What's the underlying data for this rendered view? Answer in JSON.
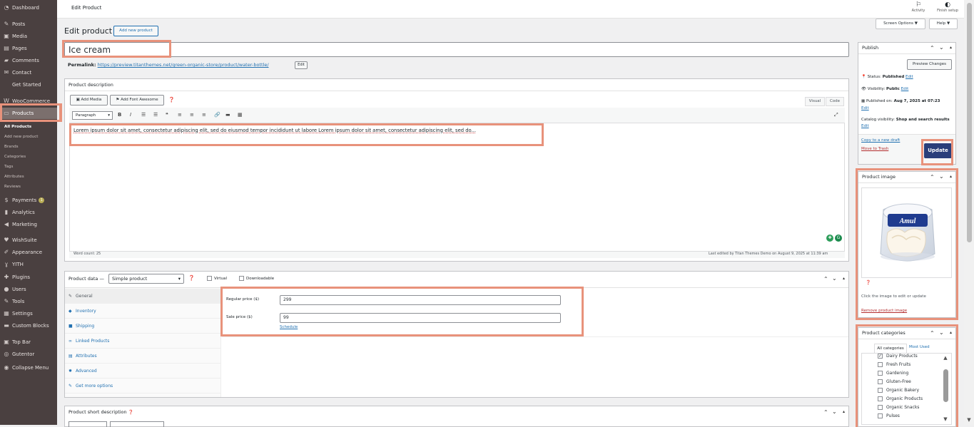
{
  "sidebar": {
    "items": [
      {
        "icon": "dashboard-icon",
        "glyph": "◔",
        "label": "Dashboard"
      },
      {
        "icon": "pin-icon",
        "glyph": "✎",
        "label": "Posts"
      },
      {
        "icon": "media-icon",
        "glyph": "▣",
        "label": "Media"
      },
      {
        "icon": "pages-icon",
        "glyph": "▤",
        "label": "Pages"
      },
      {
        "icon": "comments-icon",
        "glyph": "▰",
        "label": "Comments"
      },
      {
        "icon": "contact-icon",
        "glyph": "✉",
        "label": "Contact"
      },
      {
        "icon": "",
        "glyph": "",
        "label": "Get Started"
      },
      {
        "icon": "woocommerce-icon",
        "glyph": "W",
        "label": "WooCommerce"
      },
      {
        "icon": "products-icon",
        "glyph": "▭",
        "label": "Products"
      }
    ],
    "sub_items": [
      "All Products",
      "Add new product",
      "Brands",
      "Categories",
      "Tags",
      "Attributes",
      "Reviews"
    ],
    "items2": [
      {
        "icon": "payments-icon",
        "glyph": "$",
        "label": "Payments",
        "badge": "1"
      },
      {
        "icon": "analytics-icon",
        "glyph": "▮",
        "label": "Analytics"
      },
      {
        "icon": "marketing-icon",
        "glyph": "◀",
        "label": "Marketing"
      },
      {
        "icon": "heart-icon",
        "glyph": "♥",
        "label": "WishSuite"
      },
      {
        "icon": "appearance-icon",
        "glyph": "✐",
        "label": "Appearance"
      },
      {
        "icon": "yith-icon",
        "glyph": "ɣ",
        "label": "YITH"
      },
      {
        "icon": "plugins-icon",
        "glyph": "✚",
        "label": "Plugins"
      },
      {
        "icon": "users-icon",
        "glyph": "●",
        "label": "Users"
      },
      {
        "icon": "tools-icon",
        "glyph": "✎",
        "label": "Tools"
      },
      {
        "icon": "settings-icon",
        "glyph": "▦",
        "label": "Settings"
      },
      {
        "icon": "blocks-icon",
        "glyph": "▬",
        "label": "Custom Blocks"
      },
      {
        "icon": "topbar-icon",
        "glyph": "▣",
        "label": "Top Bar"
      },
      {
        "icon": "gutentor-icon",
        "glyph": "◎",
        "label": "Gutentor"
      },
      {
        "icon": "collapse-icon",
        "glyph": "◉",
        "label": "Collapse Menu"
      }
    ]
  },
  "topbar": {
    "title": "Edit Product",
    "activity": "Activity",
    "finish_setup": "Finish setup"
  },
  "header": {
    "title": "Edit product",
    "add_new": "Add new product",
    "screen_options": "Screen Options ▼",
    "help": "Help ▼"
  },
  "product": {
    "name": "Ice cream",
    "permalink_label": "Permalink:",
    "permalink_url": "https://preview.titanthemes.net/green-organic-store/product/water-bottle/",
    "permalink_edit": "Edit"
  },
  "description": {
    "title": "Product description",
    "add_media": "Add Media",
    "add_font_awesome": "Add Font Awesome",
    "tab_visual": "Visual",
    "tab_code": "Code",
    "format": "Paragraph",
    "content": "Lorem ipsum dolor sit amet, consectetur adipiscing elit, sed do eiusmod tempor incididunt ut labore Lorem ipsum dolor sit amet, consectetur adipiscing elit, sed do...",
    "word_count": "Word count: 25",
    "last_edited": "Last edited by Titan Themes Demo on August 9, 2025 at 11:39 am"
  },
  "product_data": {
    "title": "Product data —",
    "type": "Simple product",
    "virtual": "Virtual",
    "downloadable": "Downloadable",
    "tabs": [
      {
        "label": "General",
        "icon": "wrench-icon",
        "glyph": "✎"
      },
      {
        "label": "Inventory",
        "icon": "inventory-icon",
        "glyph": "◆"
      },
      {
        "label": "Shipping",
        "icon": "shipping-icon",
        "glyph": "■"
      },
      {
        "label": "Linked Products",
        "icon": "link-icon",
        "glyph": "∞"
      },
      {
        "label": "Attributes",
        "icon": "attributes-icon",
        "glyph": "▤"
      },
      {
        "label": "Advanced",
        "icon": "gear-icon",
        "glyph": "✹"
      },
      {
        "label": "Get more options",
        "icon": "plugin-icon",
        "glyph": "✎"
      }
    ],
    "regular_price_label": "Regular price ($)",
    "regular_price": "299",
    "sale_price_label": "Sale price ($)",
    "sale_price": "99",
    "schedule": "Schedule"
  },
  "short_description": {
    "title": "Product short description"
  },
  "publish": {
    "title": "Publish",
    "preview": "Preview Changes",
    "status_label": "Status:",
    "status": "Published",
    "visibility_label": "Visibility:",
    "visibility": "Public",
    "published_label": "Published on:",
    "published": "Aug 7, 2025 at 07:23",
    "edit": "Edit",
    "catalog_label": "Catalog visibility:",
    "catalog": "Shop and search results",
    "copy_draft": "Copy to a new draft",
    "trash": "Move to Trash",
    "update": "Update"
  },
  "product_image": {
    "title": "Product image",
    "brand": "Amul",
    "hint": "Click the image to edit or update",
    "remove": "Remove product image"
  },
  "categories": {
    "title": "Product categories",
    "tab_all": "All categories",
    "tab_most": "Most Used",
    "items": [
      {
        "label": "Dairy Products",
        "checked": true
      },
      {
        "label": "Fresh Fruits",
        "checked": false
      },
      {
        "label": "Gardening",
        "checked": false
      },
      {
        "label": "Gluten-Free",
        "checked": false
      },
      {
        "label": "Organic Bakery",
        "checked": false
      },
      {
        "label": "Organic Products",
        "checked": false
      },
      {
        "label": "Organic Snacks",
        "checked": false
      },
      {
        "label": "Pulses",
        "checked": false
      }
    ]
  },
  "colors": {
    "accent": "#2271b1",
    "highlight": "#e8927b",
    "update_button": "#2a3e7a",
    "sidebar": "#4a4040"
  }
}
